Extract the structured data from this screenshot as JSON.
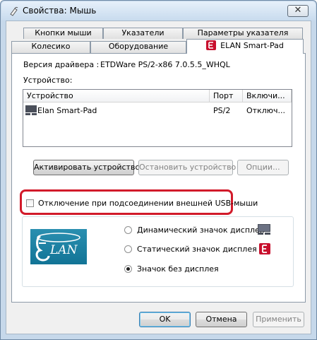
{
  "window": {
    "title": "Свойства: Мышь",
    "close_label": "✕"
  },
  "tabs": {
    "row_back": [
      "Кнопки мыши",
      "Указатели",
      "Параметры указателя"
    ],
    "row_front": [
      "Колесико",
      "Оборудование",
      "ELAN Smart-Pad"
    ],
    "active": "ELAN Smart-Pad"
  },
  "driver": {
    "version_label": "Версия драйвера :",
    "version_value": "ETDWare PS/2-x86 7.0.5.5_WHQL",
    "device_label": "Устройство:"
  },
  "device_list": {
    "columns": [
      "Устройство",
      "Порт",
      "Включи..."
    ],
    "rows": [
      {
        "device": "Elan Smart-Pad",
        "port": "PS/2",
        "enabled": "Отключ..."
      }
    ]
  },
  "buttons": {
    "activate": "Активировать устройство",
    "stop": "Остановить устройство",
    "options": "Опции..."
  },
  "usb_disable": {
    "label": "Отключение при подсоединении внешней USB-мыши",
    "checked": false
  },
  "icon_options": [
    {
      "label": "Динамический значок дисплея",
      "selected": false,
      "icon": "touchpad-icon"
    },
    {
      "label": "Статический значок дисплея",
      "selected": false,
      "icon": "elan-icon"
    },
    {
      "label": "Значок без дисплея",
      "selected": true,
      "icon": ""
    }
  ],
  "logo": {
    "text": "LAN",
    "accent": "#1a7fa3"
  },
  "footer": {
    "ok": "OK",
    "cancel": "Отмена",
    "apply": "Применить"
  },
  "colors": {
    "highlight": "#d21a2a",
    "elan_red": "#c8102e",
    "logo_blue": "#1a7fa3"
  }
}
